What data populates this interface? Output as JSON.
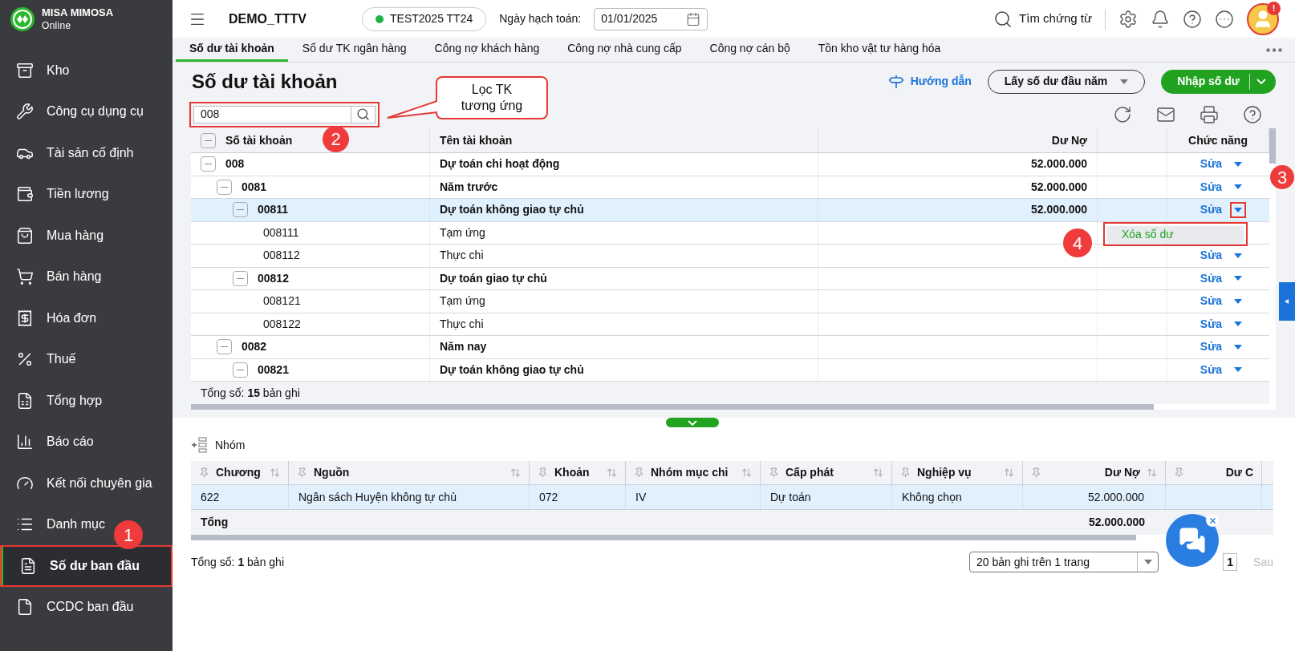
{
  "brand": {
    "name": "MISA MIMOSA",
    "sub": "Online"
  },
  "sidebar": {
    "items": [
      {
        "label": "Kho",
        "selected": false,
        "highlighted": false
      },
      {
        "label": "Công cụ dụng cụ",
        "selected": false,
        "highlighted": false
      },
      {
        "label": "Tài sản cố định",
        "selected": false,
        "highlighted": false
      },
      {
        "label": "Tiền lương",
        "selected": false,
        "highlighted": false
      },
      {
        "label": "Mua hàng",
        "selected": false,
        "highlighted": false
      },
      {
        "label": "Bán hàng",
        "selected": false,
        "highlighted": false
      },
      {
        "label": "Hóa đơn",
        "selected": false,
        "highlighted": false
      },
      {
        "label": "Thuế",
        "selected": false,
        "highlighted": false
      },
      {
        "label": "Tổng hợp",
        "selected": false,
        "highlighted": false
      },
      {
        "label": "Báo cáo",
        "selected": false,
        "highlighted": false
      },
      {
        "label": "Kết nối chuyên gia",
        "selected": false,
        "highlighted": false
      },
      {
        "label": "Danh mục",
        "selected": false,
        "highlighted": false
      },
      {
        "label": "Số dư ban đầu",
        "selected": true,
        "highlighted": true
      },
      {
        "label": "CCDC ban đầu",
        "selected": false,
        "highlighted": false
      }
    ]
  },
  "topbar": {
    "company": "DEMO_TTTV",
    "database": "TEST2025 TT24",
    "date_label": "Ngày hạch toán:",
    "date": "01/01/2025",
    "search_label": "Tìm chứng từ",
    "alert": "!"
  },
  "tabs": [
    {
      "label": "Số dư tài khoản",
      "selected": true
    },
    {
      "label": "Số dư TK ngân hàng",
      "selected": false
    },
    {
      "label": "Công nợ khách hàng",
      "selected": false
    },
    {
      "label": "Công nợ nhà cung cấp",
      "selected": false
    },
    {
      "label": "Công nợ cán bộ",
      "selected": false
    },
    {
      "label": "Tồn kho vật tư hàng hóa",
      "selected": false
    }
  ],
  "page": {
    "title": "Số dư tài khoản",
    "guide": "Hướng dẫn",
    "fetch_button": "Lấy số dư đầu năm",
    "primary_button": "Nhập số dư"
  },
  "search": {
    "value": "008",
    "highlighted": true
  },
  "callout": {
    "text": "Lọc TK tương ứng"
  },
  "grid": {
    "columns": [
      "Số tài khoản",
      "Tên tài khoản",
      "Dư Nợ",
      "Chức năng"
    ],
    "rows": [
      {
        "account": "008",
        "name": "Dự toán chi hoạt động",
        "debit": "52.000.000",
        "action": "Sửa",
        "selected": false,
        "arrow_highlighted": false,
        "expanded": true,
        "children": [
          {
            "account": "0081",
            "name": "Năm trước",
            "debit": "52.000.000",
            "action": "Sửa",
            "selected": false,
            "arrow_highlighted": false,
            "expanded": true,
            "children": [
              {
                "account": "00811",
                "name": "Dự toán không giao tự chủ",
                "debit": "52.000.000",
                "action": "Sửa",
                "selected": true,
                "arrow_highlighted": true,
                "expanded": true,
                "children": [
                  {
                    "account": "008111",
                    "name": "Tạm ứng",
                    "selected": false
                  },
                  {
                    "account": "008112",
                    "name": "Thực chi",
                    "action": "Sửa",
                    "selected": false,
                    "arrow_highlighted": false
                  }
                ]
              },
              {
                "account": "00812",
                "name": "Dự toán giao tự chủ",
                "action": "Sửa",
                "selected": false,
                "arrow_highlighted": false,
                "expanded": true,
                "children": [
                  {
                    "account": "008121",
                    "name": "Tạm ứng",
                    "action": "Sửa",
                    "selected": false,
                    "arrow_highlighted": false
                  },
                  {
                    "account": "008122",
                    "name": "Thực chi",
                    "action": "Sửa",
                    "selected": false,
                    "arrow_highlighted": false
                  }
                ]
              }
            ]
          },
          {
            "account": "0082",
            "name": "Năm nay",
            "action": "Sửa",
            "selected": false,
            "arrow_highlighted": false,
            "expanded": true,
            "children": [
              {
                "account": "00821",
                "name": "Dự toán không giao tự chủ",
                "action": "Sửa",
                "selected": false,
                "arrow_highlighted": false,
                "expanded": true
              }
            ]
          }
        ]
      }
    ],
    "total_prefix": "Tổng số:",
    "total_count": "15",
    "total_suffix": "bản ghi"
  },
  "row_menu": {
    "items": [
      "Xóa số dư"
    ],
    "highlighted": true
  },
  "steps": [
    "1",
    "2",
    "3",
    "4"
  ],
  "detail": {
    "group_button": "Nhóm",
    "columns": [
      "Chương",
      "Nguồn",
      "Khoản",
      "Nhóm mục chi",
      "Cấp phát",
      "Nghiệp vụ",
      "Dư Nợ",
      "Dư C"
    ],
    "rows": [
      {
        "cells": [
          "622",
          "Ngân sách Huyện không tự chủ",
          "072",
          "IV",
          "Dự toán",
          "Không chọn",
          "52.000.000",
          ""
        ],
        "selected": true
      }
    ],
    "total": {
      "label": "Tổng",
      "debit": "52.000.000"
    },
    "total_prefix": "Tổng số:",
    "total_count": "1",
    "total_suffix": "bản ghi",
    "page_size": "20 bản ghi trên 1 trang",
    "page": "1",
    "next": "Sau",
    "next_disabled": true
  }
}
